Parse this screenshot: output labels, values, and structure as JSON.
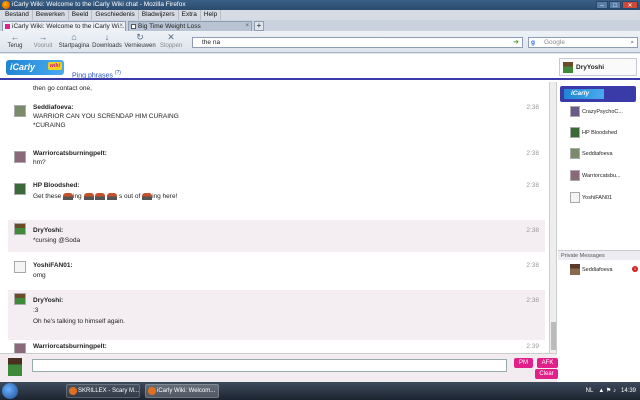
{
  "window": {
    "title": "iCarly Wiki: Welcome to the iCarly Wiki chat - Mozilla Firefox"
  },
  "menu": [
    "Bestand",
    "Bewerken",
    "Beeld",
    "Geschiedenis",
    "Bladwijzers",
    "Extra",
    "Help"
  ],
  "tabs": [
    {
      "label": "iCarly Wiki: Welcome to the iCarly Wi...",
      "active": true
    },
    {
      "label": "Big Time Weight Loss",
      "active": false
    }
  ],
  "nav": {
    "back": "Terug",
    "forward": "Vooruit",
    "home": "Startpagina",
    "downloads": "Downloads",
    "reload": "Vernieuwen",
    "stop": "Stoppen",
    "url": "the na",
    "search_placeholder": "Google"
  },
  "header": {
    "ping_label": "Ping phrases",
    "ping_help": "(?)",
    "username": "DryYoshi"
  },
  "messages": [
    {
      "name": "Warriorcatsburningpelt:",
      "lines": [
        "then go contact one,"
      ],
      "time": "",
      "alt": false
    },
    {
      "name": "Seddiafoeva:",
      "lines": [
        "WARRIOR CAN YOU SCRENDAP HIM CURAING",
        "*CURAING"
      ],
      "time": "2:38",
      "alt": false
    },
    {
      "name": "Warriorcatsburningpelt:",
      "lines": [
        "hm?"
      ],
      "time": "2:38",
      "alt": false
    },
    {
      "name": "HP Bloodshed:",
      "lines": [
        "Get these"
      ],
      "line_mid": "ing",
      "line_mid2": "s out of",
      "line_end": "ing here!",
      "time": "2:38",
      "alt": false
    },
    {
      "name": "DryYoshi:",
      "lines": [
        "*cursing @Soda"
      ],
      "time": "2:38",
      "alt": true
    },
    {
      "name": "YoshiFAN01:",
      "lines": [
        "omg"
      ],
      "time": "2:38",
      "alt": false
    },
    {
      "name": "DryYoshi:",
      "lines": [
        ":3",
        "Oh he's talking to himself again."
      ],
      "time": "2:38",
      "alt": true
    },
    {
      "name": "Warriorcatsburningpelt:",
      "lines": [
        ""
      ],
      "time": "2:39",
      "alt": false
    }
  ],
  "sidebar": {
    "users": [
      "CrazyPsychoC...",
      "HP Bloodshed",
      "Seddiafoeva",
      "Warriorcatsbu...",
      "YoshiFAN01"
    ],
    "pm_header": "Private Messages",
    "pm_users": [
      "Seddiafoeva"
    ],
    "pm_count": "1"
  },
  "input": {
    "pm_label": "PM",
    "afk_label": "AFK",
    "clear_label": "Clear"
  },
  "taskbar": {
    "items": [
      "SKRILLEX - Scary M...",
      "iCarly Wiki: Welcom..."
    ],
    "lang": "NL",
    "clock": "14:39"
  },
  "colors": {
    "accent": "#e0218a",
    "header_rule": "#3a3aa8"
  }
}
